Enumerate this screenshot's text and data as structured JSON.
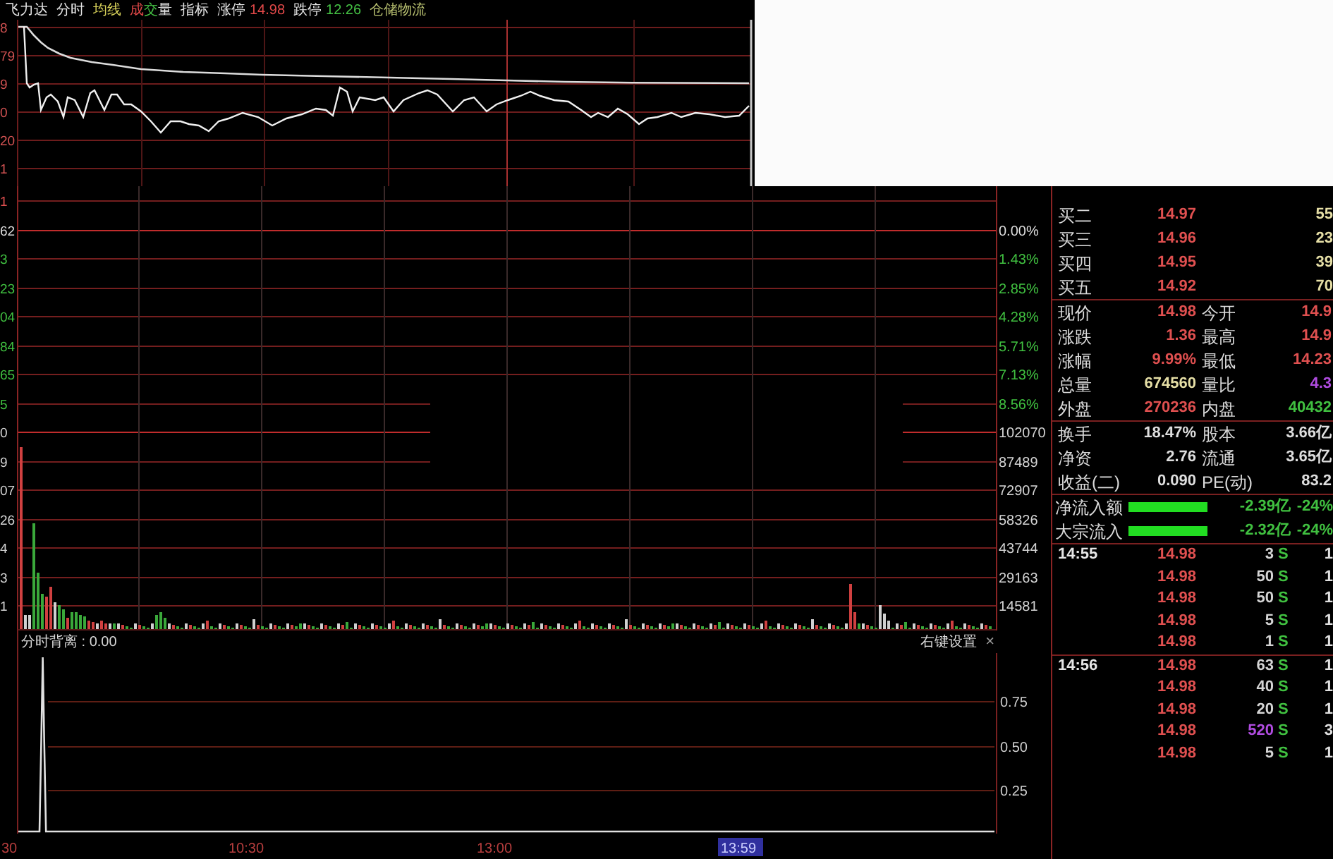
{
  "header": {
    "stock_name": "飞力达",
    "menu": [
      {
        "label": "分时",
        "color": "#e6e6e6"
      },
      {
        "label": "均线",
        "color": "#d8d25a"
      },
      {
        "parts": [
          {
            "text": "成",
            "color": "#e04848"
          },
          {
            "text": "交",
            "color": "#44c044"
          },
          {
            "text": "量",
            "color": "#e6e6e6"
          }
        ]
      },
      {
        "label": "指标",
        "color": "#e6e6e6"
      }
    ],
    "limits": [
      {
        "label": "涨停",
        "value": "14.98",
        "color": "#e04848"
      },
      {
        "label": "跌停",
        "value": "12.26",
        "color": "#44c044"
      }
    ],
    "sector": "仓储物流"
  },
  "price_chart": {
    "y_labels": [
      "8",
      "79",
      "9",
      "0",
      "20",
      "1"
    ]
  },
  "main_chart": {
    "left_labels": [
      {
        "text": "1",
        "color": "#e05050"
      },
      {
        "text": "62",
        "color": "#dedede"
      },
      {
        "text": "3",
        "color": "#40c040"
      },
      {
        "text": "23",
        "color": "#40c040"
      },
      {
        "text": "04",
        "color": "#40c040"
      },
      {
        "text": "84",
        "color": "#40c040"
      },
      {
        "text": "65",
        "color": "#40c040"
      },
      {
        "text": "5",
        "color": "#40c040"
      },
      {
        "text": "0",
        "color": "#d4d4d4"
      },
      {
        "text": "9",
        "color": "#d4d4d4"
      },
      {
        "text": "07",
        "color": "#d4d4d4"
      },
      {
        "text": "26",
        "color": "#d4d4d4"
      },
      {
        "text": "4",
        "color": "#d4d4d4"
      },
      {
        "text": "3",
        "color": "#d4d4d4"
      },
      {
        "text": "1",
        "color": "#d4d4d4"
      }
    ],
    "right_labels": [
      {
        "text": "0.00%",
        "color": "#dedede"
      },
      {
        "text": "1.43%",
        "color": "#40c040"
      },
      {
        "text": "2.85%",
        "color": "#40c040"
      },
      {
        "text": "4.28%",
        "color": "#40c040"
      },
      {
        "text": "5.71%",
        "color": "#40c040"
      },
      {
        "text": "7.13%",
        "color": "#40c040"
      },
      {
        "text": "8.56%",
        "color": "#40c040"
      },
      {
        "text": "102070",
        "color": "#d4d4d4"
      },
      {
        "text": "87489",
        "color": "#d4d4d4"
      },
      {
        "text": "72907",
        "color": "#d4d4d4"
      },
      {
        "text": "58326",
        "color": "#d4d4d4"
      },
      {
        "text": "43744",
        "color": "#d4d4d4"
      },
      {
        "text": "29163",
        "color": "#d4d4d4"
      },
      {
        "text": "14581",
        "color": "#d4d4d4"
      }
    ]
  },
  "indicator": {
    "title": "分时背离 : 0.00",
    "hint": "右键设置",
    "close": "×",
    "y_labels": [
      "0.75",
      "0.50",
      "0.25"
    ]
  },
  "time_axis": [
    {
      "label": "30",
      "selected": false
    },
    {
      "label": "10:30",
      "selected": false
    },
    {
      "label": "13:00",
      "selected": false
    },
    {
      "label": "13:59",
      "selected": true
    }
  ],
  "quote_panel": {
    "order_book": [
      {
        "label": "买二",
        "price": "14.97",
        "volume": "55"
      },
      {
        "label": "买三",
        "price": "14.96",
        "volume": "23"
      },
      {
        "label": "买四",
        "price": "14.95",
        "volume": "39"
      },
      {
        "label": "买五",
        "price": "14.92",
        "volume": "70"
      }
    ],
    "quote": [
      {
        "left": {
          "label": "现价",
          "value": "14.98",
          "color": "#e05050"
        },
        "right": {
          "label": "今开",
          "value": "14.9",
          "color": "#e05050"
        }
      },
      {
        "left": {
          "label": "涨跌",
          "value": "1.36",
          "color": "#e05050"
        },
        "right": {
          "label": "最高",
          "value": "14.9",
          "color": "#e05050"
        }
      },
      {
        "left": {
          "label": "涨幅",
          "value": "9.99%",
          "color": "#e05050"
        },
        "right": {
          "label": "最低",
          "value": "14.23",
          "color": "#e05050"
        }
      },
      {
        "left": {
          "label": "总量",
          "value": "674560",
          "color": "#e6dfa6"
        },
        "right": {
          "label": "量比",
          "value": "4.3",
          "color": "#b04ce0"
        }
      },
      {
        "left": {
          "label": "外盘",
          "value": "270236",
          "color": "#e05050"
        },
        "right": {
          "label": "内盘",
          "value": "40432",
          "color": "#40c040"
        }
      }
    ],
    "fundamentals": [
      {
        "left": {
          "label": "换手",
          "value": "18.47%"
        },
        "right": {
          "label": "股本",
          "value": "3.66亿"
        }
      },
      {
        "left": {
          "label": "净资",
          "value": "2.76"
        },
        "right": {
          "label": "流通",
          "value": "3.65亿"
        }
      },
      {
        "left": {
          "label": "收益(二)",
          "value": "0.090"
        },
        "right": {
          "label": "PE(动)",
          "value": "83.2"
        }
      }
    ],
    "fund_flow": [
      {
        "label": "净流入额",
        "value": "-2.39亿",
        "share": "-24%",
        "color": "#40c040"
      },
      {
        "label": "大宗流入",
        "value": "-2.32亿",
        "share": "-24%",
        "color": "#40c040"
      }
    ],
    "trades": [
      {
        "time": "14:55",
        "rows": [
          {
            "price": "14.98",
            "volume": {
              "value": "3",
              "color": "#d4d4d4"
            },
            "side": "S",
            "column_5": "1"
          },
          {
            "price": "14.98",
            "volume": {
              "value": "50",
              "color": "#d4d4d4"
            },
            "side": "S",
            "column_5": "1"
          },
          {
            "price": "14.98",
            "volume": {
              "value": "50",
              "color": "#d4d4d4"
            },
            "side": "S",
            "column_5": "1"
          },
          {
            "price": "14.98",
            "volume": {
              "value": "5",
              "color": "#d4d4d4"
            },
            "side": "S",
            "column_5": "1"
          },
          {
            "price": "14.98",
            "volume": {
              "value": "1",
              "color": "#d4d4d4"
            },
            "side": "S",
            "column_5": "1"
          }
        ]
      },
      {
        "time": "14:56",
        "rows": [
          {
            "price": "14.98",
            "volume": {
              "value": "63",
              "color": "#d4d4d4"
            },
            "side": "S",
            "column_5": "1"
          },
          {
            "price": "14.98",
            "volume": {
              "value": "40",
              "color": "#d4d4d4"
            },
            "side": "S",
            "column_5": "1"
          },
          {
            "price": "14.98",
            "volume": {
              "value": "20",
              "color": "#d4d4d4"
            },
            "side": "S",
            "column_5": "1"
          },
          {
            "price": "14.98",
            "volume": {
              "value": "520",
              "color": "#b04ce0"
            },
            "side": "S",
            "column_5": "3"
          },
          {
            "price": "14.98",
            "volume": {
              "value": "5",
              "color": "#d4d4d4"
            },
            "side": "S",
            "column_5": "1"
          }
        ]
      }
    ]
  }
}
